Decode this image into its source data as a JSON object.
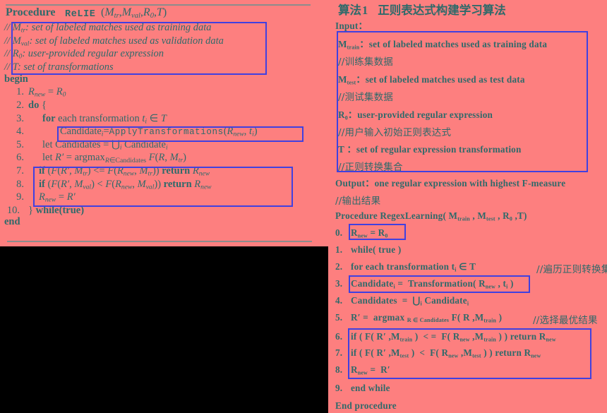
{
  "page": {
    "background_color": "#fd7f7f",
    "text_color": "#2f6a6a",
    "highlight_box_color": "#4040e0",
    "rule_color": "#8c8c8c",
    "occluded_region_color": "#000000"
  },
  "left_panel": {
    "title_prefix": "Procedure",
    "title_name": "ReLIE",
    "title_args": "(ℳtr,ℳval,R0,𝒯)",
    "comments": [
      "// ℳtr: set of labeled matches used as training data",
      "// ℳval: set of labeled matches used as validation data",
      "// R0: user-provided regular expression",
      "// 𝒯: set of transformations"
    ],
    "begin_label": "begin",
    "end_label": "end",
    "lines": [
      {
        "num": "1.",
        "text": "Rnew = R0"
      },
      {
        "num": "2.",
        "text": "do {"
      },
      {
        "num": "3.",
        "text": "for each transformation ti ∈ 𝒯"
      },
      {
        "num": "4.",
        "text": "Candidatei=ApplyTransformations(Rnew, ti)"
      },
      {
        "num": "5.",
        "text": "let Candidates = ⋃i Candidatei"
      },
      {
        "num": "6.",
        "text": "let R′ = argmax R∈Candidates ℱ(R, ℳtr)"
      },
      {
        "num": "7.",
        "text": "if (ℱ(R′, ℳtr) <= ℱ(Rnew, ℳtr)) return Rnew"
      },
      {
        "num": "8.",
        "text": "if (ℱ(R′, ℳval) < ℱ(Rnew, ℳval)) return Rnew"
      },
      {
        "num": "9.",
        "text": "Rnew = R′"
      },
      {
        "num": "10.",
        "text": "} while(true)"
      }
    ]
  },
  "right_panel": {
    "title": {
      "label": "算法",
      "number": "1",
      "subtitle": "正则表达式构建学习算法"
    },
    "input_label": "Input：",
    "input_items": [
      {
        "en": "Mtrain：set of labeled matches used as training data",
        "cn": "//训练集数据"
      },
      {
        "en": "Mtest：set of labeled matches used as test data",
        "cn": "//测试集数据"
      },
      {
        "en": "R0：user-provided regular expression",
        "cn": "//用户输入初始正则表达式"
      },
      {
        "en": "T：set of regular expression transformation",
        "cn": "//正则转换集合"
      }
    ],
    "output_label": "Output：one regular expression with highest F-measure",
    "output_cn": "//输出结果",
    "procedure_signature": "Procedure RegexLearning( Mtrain , Mtest , R0 ,T)",
    "lines": [
      {
        "num": "0.",
        "text": "Rnew = R0",
        "comment": ""
      },
      {
        "num": "1.",
        "text": "while( true )",
        "comment": ""
      },
      {
        "num": "2.",
        "text": "for each transformation ti ∈ T",
        "comment": "//遍历正则转换集合"
      },
      {
        "num": "3.",
        "text": "Candidatei = Transformation( Rnew , ti )",
        "comment": ""
      },
      {
        "num": "4.",
        "text": "Candidates = ⋃i Candidatei",
        "comment": ""
      },
      {
        "num": "5.",
        "text": "R′ = argmax R∈Candidates F( R ,Mtrain )",
        "comment": "//选择最优结果"
      },
      {
        "num": "6.",
        "text": "if ( F( R′ ,Mtrain )  < =  F( Rnew ,Mtrain ) ) return Rnew",
        "comment": ""
      },
      {
        "num": "7.",
        "text": "if ( F( R′ ,Mtest )  <  F( Rnew ,Mtest ) ) return Rnew",
        "comment": ""
      },
      {
        "num": "8.",
        "text": "Rnew = R′",
        "comment": ""
      },
      {
        "num": "9.",
        "text": "end while",
        "comment": ""
      }
    ],
    "end_procedure": "End procedure"
  }
}
